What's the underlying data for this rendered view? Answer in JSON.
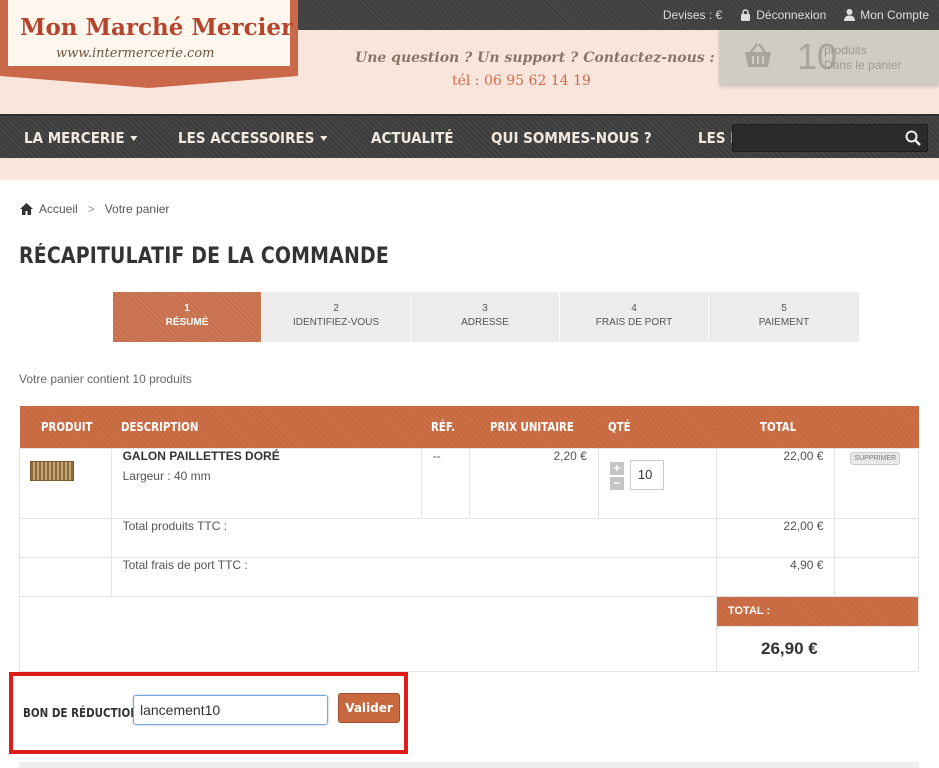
{
  "header": {
    "logo_title": "Mon Marché Mercier",
    "logo_sub": "www.intermercerie.com",
    "topbar": {
      "devises": "Devises : €",
      "deconnexion": "Déconnexion",
      "compte": "Mon Compte"
    },
    "question": "Une question ? Un support ? Contactez-nous :",
    "phone": "tél : 06 95 62 14 19",
    "cart": {
      "count": "10",
      "line1": "produits",
      "line2": "Dans le panier"
    }
  },
  "nav": {
    "items": [
      "LA MERCERIE",
      "LES ACCESSOIRES",
      "ACTUALITÉ",
      "QUI SOMMES-NOUS ?",
      "LES BONS PLANS"
    ],
    "search_placeholder": ""
  },
  "breadcrumb": {
    "home": "Accueil",
    "sep": ">",
    "current": "Votre panier"
  },
  "page_title": "RÉCAPITULATIF DE LA COMMANDE",
  "steps": [
    {
      "num": "1",
      "label": "RÉSUMÉ"
    },
    {
      "num": "2",
      "label": "IDENTIFIEZ-VOUS"
    },
    {
      "num": "3",
      "label": "ADRESSE"
    },
    {
      "num": "4",
      "label": "FRAIS DE PORT"
    },
    {
      "num": "5",
      "label": "PAIEMENT"
    }
  ],
  "summary_text": "Votre panier contient 10 produits",
  "table": {
    "headers": {
      "produit": "PRODUIT",
      "description": "DESCRIPTION",
      "ref": "RÉF.",
      "prix": "PRIX UNITAIRE",
      "qte": "QTÉ",
      "total": "TOTAL"
    },
    "item": {
      "name": "GALON PAILLETTES DORÉ",
      "attr": "Largeur : 40 mm",
      "ref": "--",
      "unit_price": "2,20 €",
      "qty": "10",
      "plus": "+",
      "minus": "−",
      "total": "22,00 €",
      "delete": "SUPPRIMER"
    },
    "total_products_label": "Total produits TTC :",
    "total_products": "22,00 €",
    "shipping_label": "Total frais de port TTC :",
    "shipping": "4,90 €",
    "grand_total_label": "TOTAL :",
    "grand_total": "26,90 €"
  },
  "voucher": {
    "label": "BON DE RÉDUCTION",
    "value": "lancement10",
    "button": "Valider"
  },
  "colors": {
    "accent": "#c8683f",
    "highlight_border": "#e01b1b",
    "header_bg": "#f9e5dc",
    "nav_bg": "#3c3c3c"
  }
}
